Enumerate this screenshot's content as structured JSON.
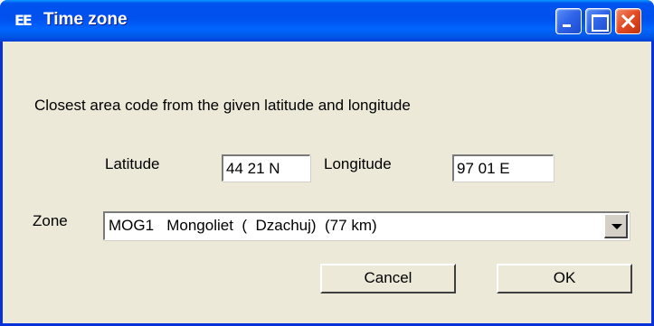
{
  "window": {
    "title": "Time zone",
    "icon": "app-ee-icon",
    "controls": [
      "minimize",
      "maximize",
      "close"
    ]
  },
  "description": "Closest area code from the given latitude and longitude",
  "latitude": {
    "label": "Latitude",
    "value": "44 21 N"
  },
  "longitude": {
    "label": "Longitude",
    "value": "97 01 E"
  },
  "zone": {
    "label": "Zone",
    "selected": "MOG1   Mongoliet  (  Dzachuj)  (77 km)"
  },
  "buttons": {
    "cancel": "Cancel",
    "ok": "OK"
  },
  "colors": {
    "titlebar": "#0054e3",
    "dialog_bg": "#ece9d8",
    "close_button": "#e24a22"
  }
}
